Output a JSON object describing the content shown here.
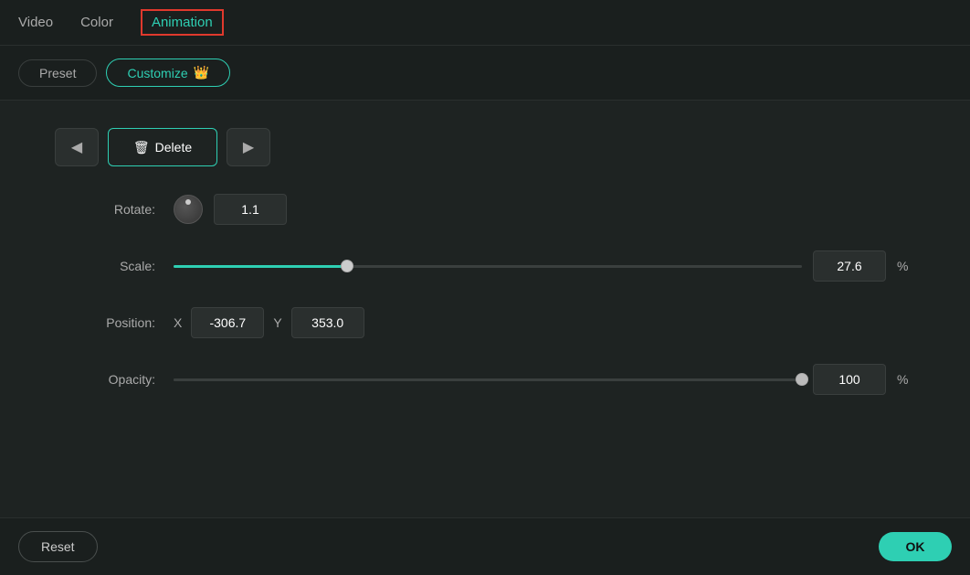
{
  "tabs": [
    {
      "id": "video",
      "label": "Video",
      "active": false
    },
    {
      "id": "color",
      "label": "Color",
      "active": false
    },
    {
      "id": "animation",
      "label": "Animation",
      "active": true
    }
  ],
  "subtabs": [
    {
      "id": "preset",
      "label": "Preset",
      "active": false
    },
    {
      "id": "customize",
      "label": "Customize",
      "active": true,
      "icon": "👑"
    }
  ],
  "action_buttons": {
    "back_label": "◀",
    "delete_label": "Delete",
    "forward_label": "▶"
  },
  "controls": {
    "rotate": {
      "label": "Rotate:",
      "value": "1.1"
    },
    "scale": {
      "label": "Scale:",
      "value": "27.6",
      "unit": "%",
      "percent": 27.6
    },
    "position": {
      "label": "Position:",
      "x_label": "X",
      "x_value": "-306.7",
      "y_label": "Y",
      "y_value": "353.0"
    },
    "opacity": {
      "label": "Opacity:",
      "value": "100",
      "unit": "%",
      "percent": 100
    }
  },
  "footer": {
    "reset_label": "Reset",
    "ok_label": "OK"
  },
  "colors": {
    "accent": "#2ecfb3",
    "danger": "#e0392d",
    "bg_main": "#1e2322",
    "bg_dark": "#1a1f1e",
    "border": "#3a3f3e",
    "input_bg": "#2a2f2e"
  }
}
